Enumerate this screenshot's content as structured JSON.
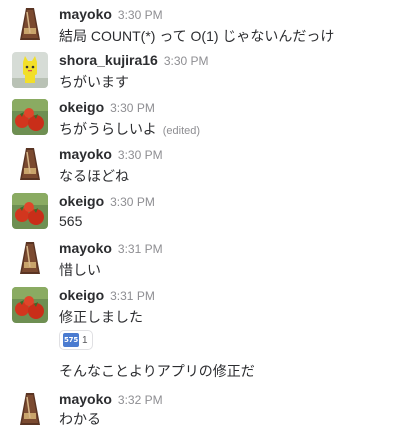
{
  "messages": [
    {
      "user": "mayoko",
      "time": "3:30 PM",
      "text": "結局 COUNT(*) って O(1) じゃないんだっけ"
    },
    {
      "user": "shora_kujira16",
      "time": "3:30 PM",
      "text": "ちがいます"
    },
    {
      "user": "okeigo",
      "time": "3:30 PM",
      "text": "ちがうらしいよ",
      "edited": "(edited)"
    },
    {
      "user": "mayoko",
      "time": "3:30 PM",
      "text": "なるほどね"
    },
    {
      "user": "okeigo",
      "time": "3:30 PM",
      "text": "565"
    },
    {
      "user": "mayoko",
      "time": "3:31 PM",
      "text": "惜しい"
    },
    {
      "user": "okeigo",
      "time": "3:31 PM",
      "text": "修正しました",
      "reaction": {
        "emoji_label": "575",
        "count": "1",
        "icon": "575-custom-emoji"
      },
      "followup": "そんなことよりアプリの修正だ"
    },
    {
      "user": "mayoko",
      "time": "3:32 PM",
      "text": "わかる"
    }
  ]
}
